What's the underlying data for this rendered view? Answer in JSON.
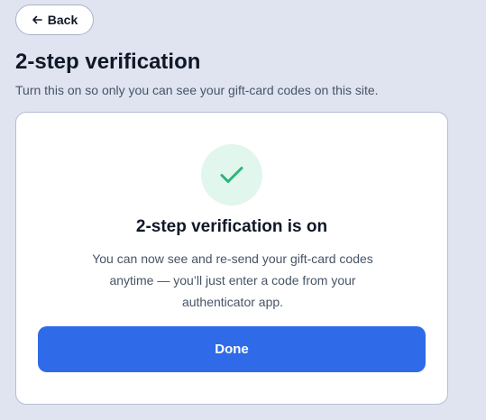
{
  "back_button": {
    "label": "Back",
    "icon": "arrow-left-icon"
  },
  "header": {
    "title": "2-step verification",
    "subtitle": "Turn this on so only you can see your gift-card codes on this site."
  },
  "card": {
    "status_icon": "check-icon",
    "title": "2-step verification is on",
    "body": "You can now see and re-send your gift-card codes anytime — you’ll just enter a code from your authenticator app.",
    "done_label": "Done"
  },
  "colors": {
    "background": "#dfe4f0",
    "accent": "#2f6be8",
    "success": "#2fb37a",
    "success_bg": "#e1f6ec"
  }
}
